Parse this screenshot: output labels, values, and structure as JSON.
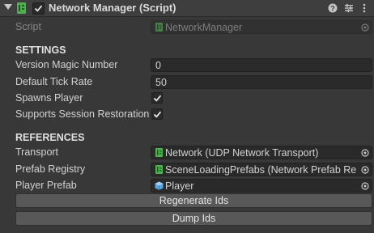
{
  "component": {
    "title": "Network Manager (Script)",
    "enabled": true
  },
  "script_row": {
    "label": "Script",
    "value": "NetworkManager"
  },
  "settings": {
    "header": "SETTINGS",
    "version_magic_number": {
      "label": "Version Magic Number",
      "value": "0"
    },
    "default_tick_rate": {
      "label": "Default Tick Rate",
      "value": "50"
    },
    "spawns_player": {
      "label": "Spawns Player",
      "checked": true
    },
    "supports_session_restoration": {
      "label": "Supports Session Restoration",
      "checked": true
    }
  },
  "references": {
    "header": "REFERENCES",
    "transport": {
      "label": "Transport",
      "value": "Network (UDP Network Transport)"
    },
    "prefab_registry": {
      "label": "Prefab Registry",
      "value": "SceneLoadingPrefabs (Network Prefab Re"
    },
    "player_prefab": {
      "label": "Player Prefab",
      "value": "Player"
    }
  },
  "buttons": {
    "regenerate_ids": "Regenerate Ids",
    "dump_ids": "Dump Ids"
  },
  "icons": {
    "foldout": "foldout-arrow-icon",
    "script": "csharp-script-icon",
    "help": "help-icon",
    "presets": "presets-icon",
    "more": "kebab-menu-icon",
    "picker": "object-picker-icon",
    "gameobject": "gameobject-icon",
    "prefab": "prefab-cube-icon"
  },
  "colors": {
    "background": "#383838",
    "field": "#2a2a2a",
    "button": "#585858",
    "script_green": "#4fb04f",
    "prefab_blue": "#5aa6e0"
  }
}
